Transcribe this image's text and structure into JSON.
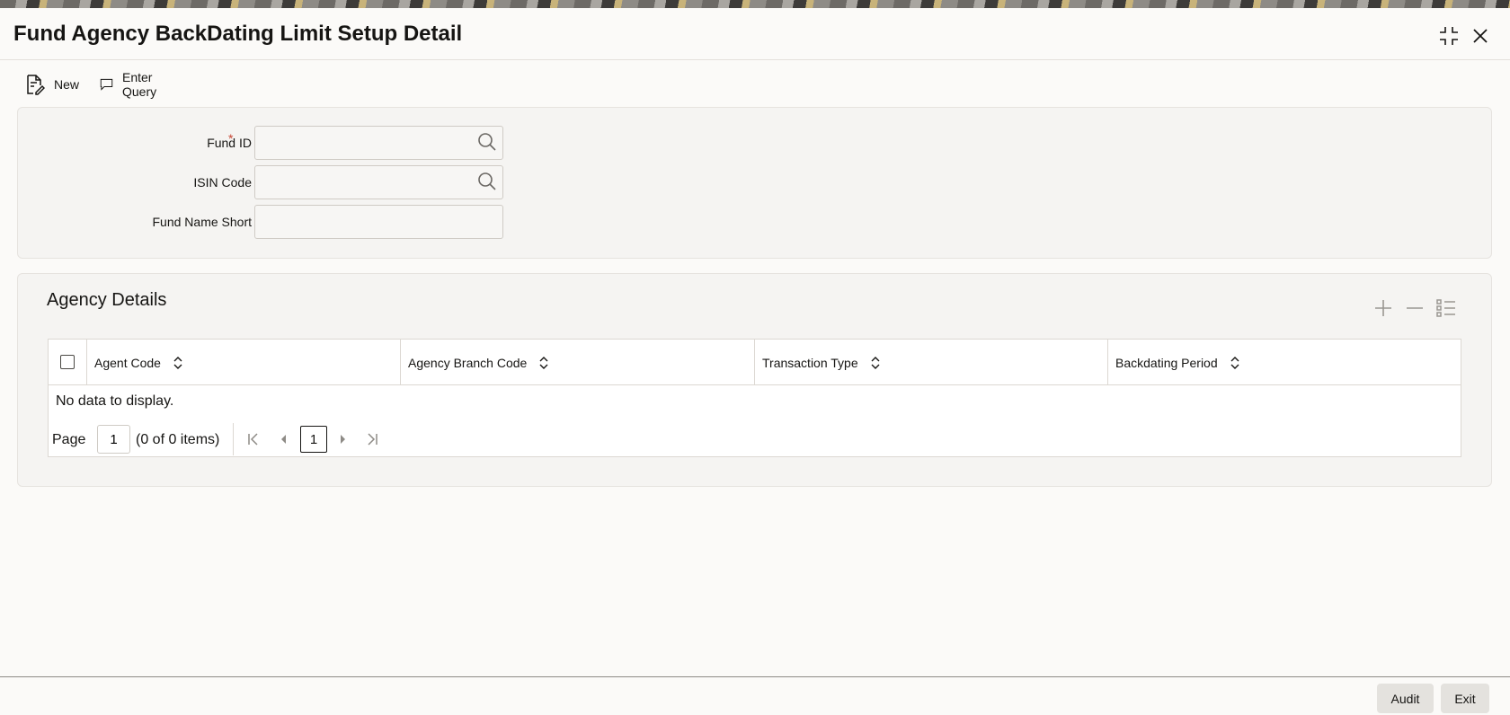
{
  "window": {
    "title": "Fund Agency BackDating Limit Setup Detail"
  },
  "toolbar": {
    "new_label": "New",
    "enter_query_label": "Enter Query"
  },
  "form": {
    "fund_id": {
      "label": "Fund ID",
      "required_marker": "*",
      "value": ""
    },
    "isin_code": {
      "label": "ISIN Code",
      "value": ""
    },
    "fund_name_short": {
      "label": "Fund Name Short",
      "value": ""
    }
  },
  "agency_details": {
    "title": "Agency Details",
    "columns": [
      "Agent Code",
      "Agency Branch Code",
      "Transaction Type",
      "Backdating Period"
    ],
    "rows": [],
    "empty_message": "No data to display.",
    "pager": {
      "page_label": "Page",
      "page_value": "1",
      "items_text": "(0 of 0 items)",
      "current_page": "1"
    }
  },
  "footer": {
    "audit_label": "Audit",
    "exit_label": "Exit"
  }
}
